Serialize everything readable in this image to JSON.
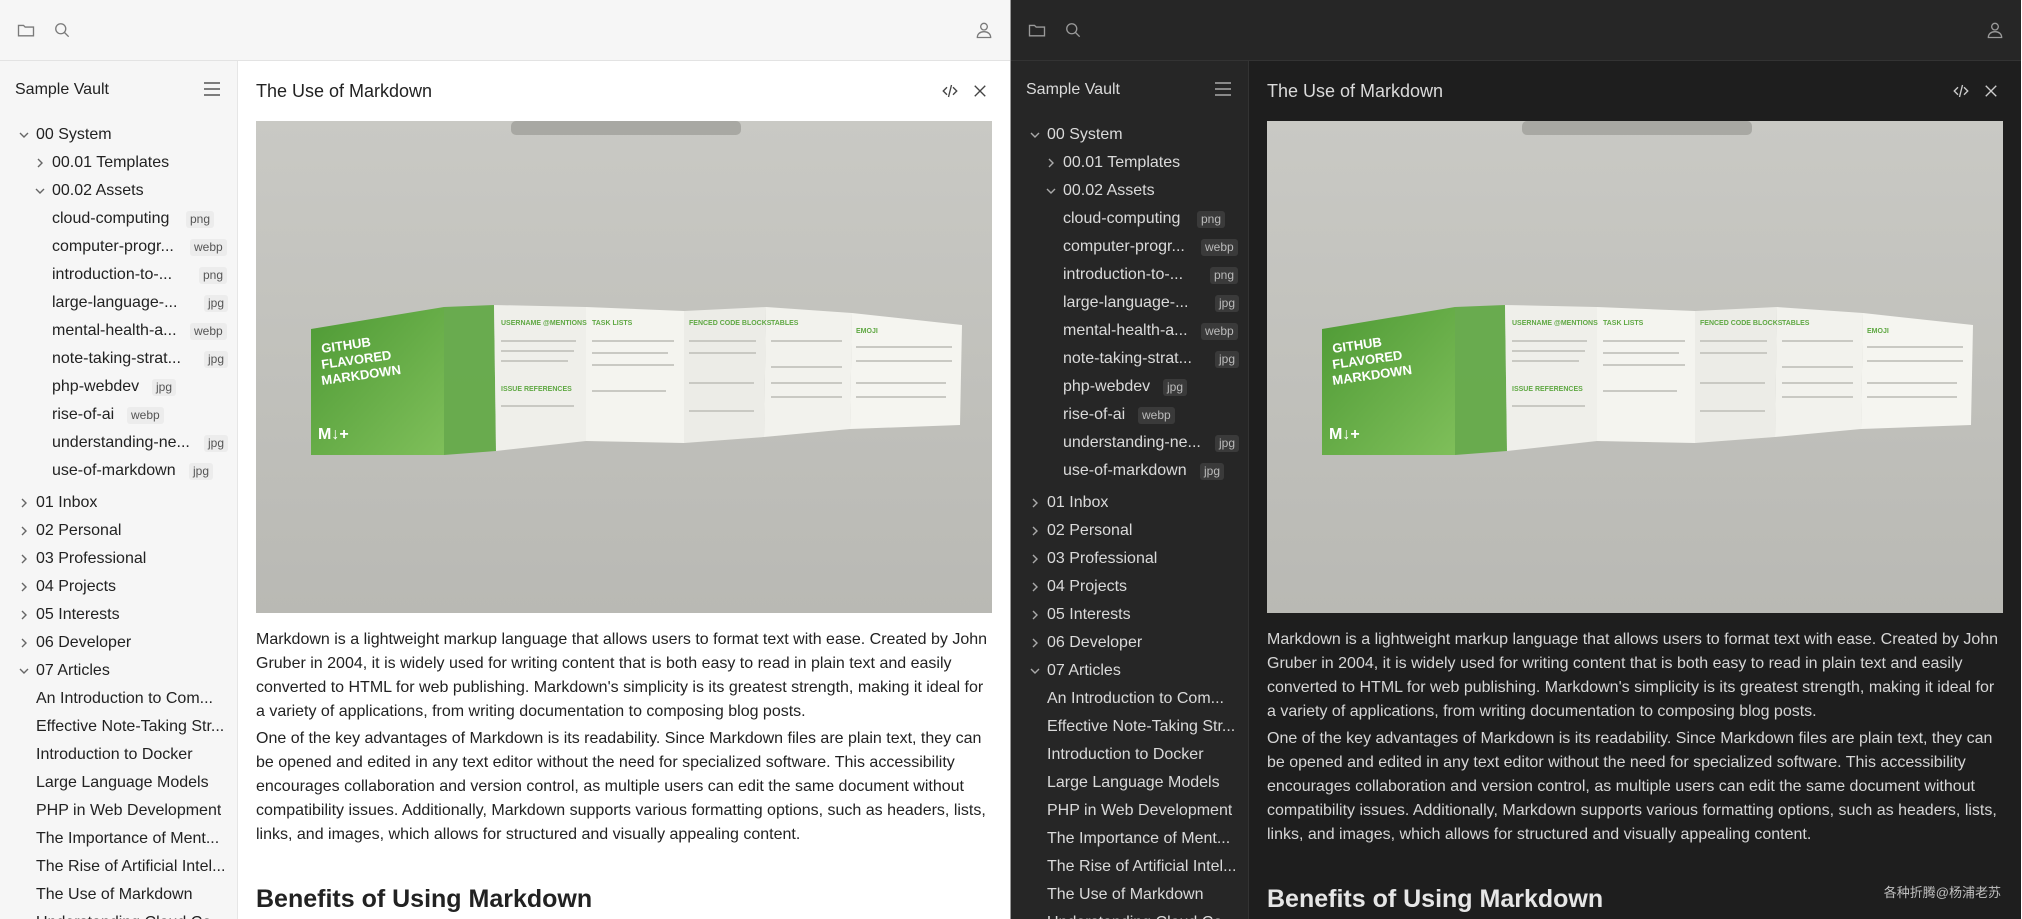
{
  "vault": {
    "name": "Sample Vault"
  },
  "tree": [
    {
      "kind": "folder",
      "label": "00 System",
      "open": true,
      "level": 0
    },
    {
      "kind": "folder",
      "label": "00.01 Templates",
      "open": false,
      "level": 1
    },
    {
      "kind": "folder",
      "label": "00.02 Assets",
      "open": true,
      "level": 1
    },
    {
      "kind": "file",
      "label": "cloud-computing",
      "ext": "png",
      "level": 2
    },
    {
      "kind": "file",
      "label": "computer-progr...",
      "ext": "webp",
      "level": 2
    },
    {
      "kind": "file",
      "label": "introduction-to-...",
      "ext": "png",
      "level": 2
    },
    {
      "kind": "file",
      "label": "large-language-...",
      "ext": "jpg",
      "level": 2
    },
    {
      "kind": "file",
      "label": "mental-health-a...",
      "ext": "webp",
      "level": 2
    },
    {
      "kind": "file",
      "label": "note-taking-strat...",
      "ext": "jpg",
      "level": 2
    },
    {
      "kind": "file",
      "label": "php-webdev",
      "ext": "jpg",
      "level": 2
    },
    {
      "kind": "file",
      "label": "rise-of-ai",
      "ext": "webp",
      "level": 2
    },
    {
      "kind": "file",
      "label": "understanding-ne...",
      "ext": "jpg",
      "level": 2
    },
    {
      "kind": "file",
      "label": "use-of-markdown",
      "ext": "jpg",
      "level": 2
    },
    {
      "kind": "folder",
      "label": "01 Inbox",
      "open": false,
      "level": 0
    },
    {
      "kind": "folder",
      "label": "02 Personal",
      "open": false,
      "level": 0
    },
    {
      "kind": "folder",
      "label": "03 Professional",
      "open": false,
      "level": 0
    },
    {
      "kind": "folder",
      "label": "04 Projects",
      "open": false,
      "level": 0
    },
    {
      "kind": "folder",
      "label": "05 Interests",
      "open": false,
      "level": 0
    },
    {
      "kind": "folder",
      "label": "06 Developer",
      "open": false,
      "level": 0
    },
    {
      "kind": "folder",
      "label": "07 Articles",
      "open": true,
      "level": 0
    },
    {
      "kind": "note",
      "label": "An Introduction to Com...",
      "level": 1
    },
    {
      "kind": "note",
      "label": "Effective Note-Taking Str...",
      "level": 1
    },
    {
      "kind": "note",
      "label": "Introduction to Docker",
      "level": 1
    },
    {
      "kind": "note",
      "label": "Large Language Models",
      "level": 1
    },
    {
      "kind": "note",
      "label": "PHP in Web Development",
      "level": 1
    },
    {
      "kind": "note",
      "label": "The Importance of Ment...",
      "level": 1
    },
    {
      "kind": "note",
      "label": "The Rise of Artificial Intel...",
      "level": 1
    },
    {
      "kind": "note",
      "label": "The Use of Markdown",
      "level": 1
    },
    {
      "kind": "note",
      "label": "Understanding Cloud Co...",
      "level": 1
    }
  ],
  "doc": {
    "title": "The Use of Markdown",
    "image_text": {
      "brochure_title": "GITHUB FLAVORED MARKDOWN",
      "panels": [
        "USERNAME @MENTIONS",
        "TASK LISTS",
        "FENCED CODE BLOCKS",
        "TABLES",
        "EMOJI"
      ],
      "panel_issue": "ISSUE REFERENCES",
      "logo": "M↓+"
    },
    "paragraph1": "Markdown is a lightweight markup language that allows users to format text with ease. Created by John Gruber in 2004, it is widely used for writing content that is both easy to read in plain text and easily converted to HTML for web publishing. Markdown's simplicity is its greatest strength, making it ideal for a variety of applications, from writing documentation to composing blog posts.",
    "paragraph2": "One of the key advantages of Markdown is its readability. Since Markdown files are plain text, they can be opened and edited in any text editor without the need for specialized software. This accessibility encourages collaboration and version control, as multiple users can edit the same document without compatibility issues. Additionally, Markdown supports various formatting options, such as headers, lists, links, and images, which allows for structured and visually appealing content.",
    "heading": "Benefits of Using Markdown"
  },
  "icons": {
    "topbar": [
      "folder-icon",
      "search-icon",
      "user-icon"
    ],
    "sidebar": [
      "hamburger-icon"
    ],
    "doc": [
      "code-icon",
      "close-icon"
    ]
  },
  "watermark": "各种折腾@杨浦老苏",
  "colors": {
    "light_bg": "#ffffff",
    "light_sidebar": "#f6f6f6",
    "dark_bg": "#1e1e1e",
    "dark_sidebar": "#262626",
    "brochure_green": "#5fa843"
  }
}
